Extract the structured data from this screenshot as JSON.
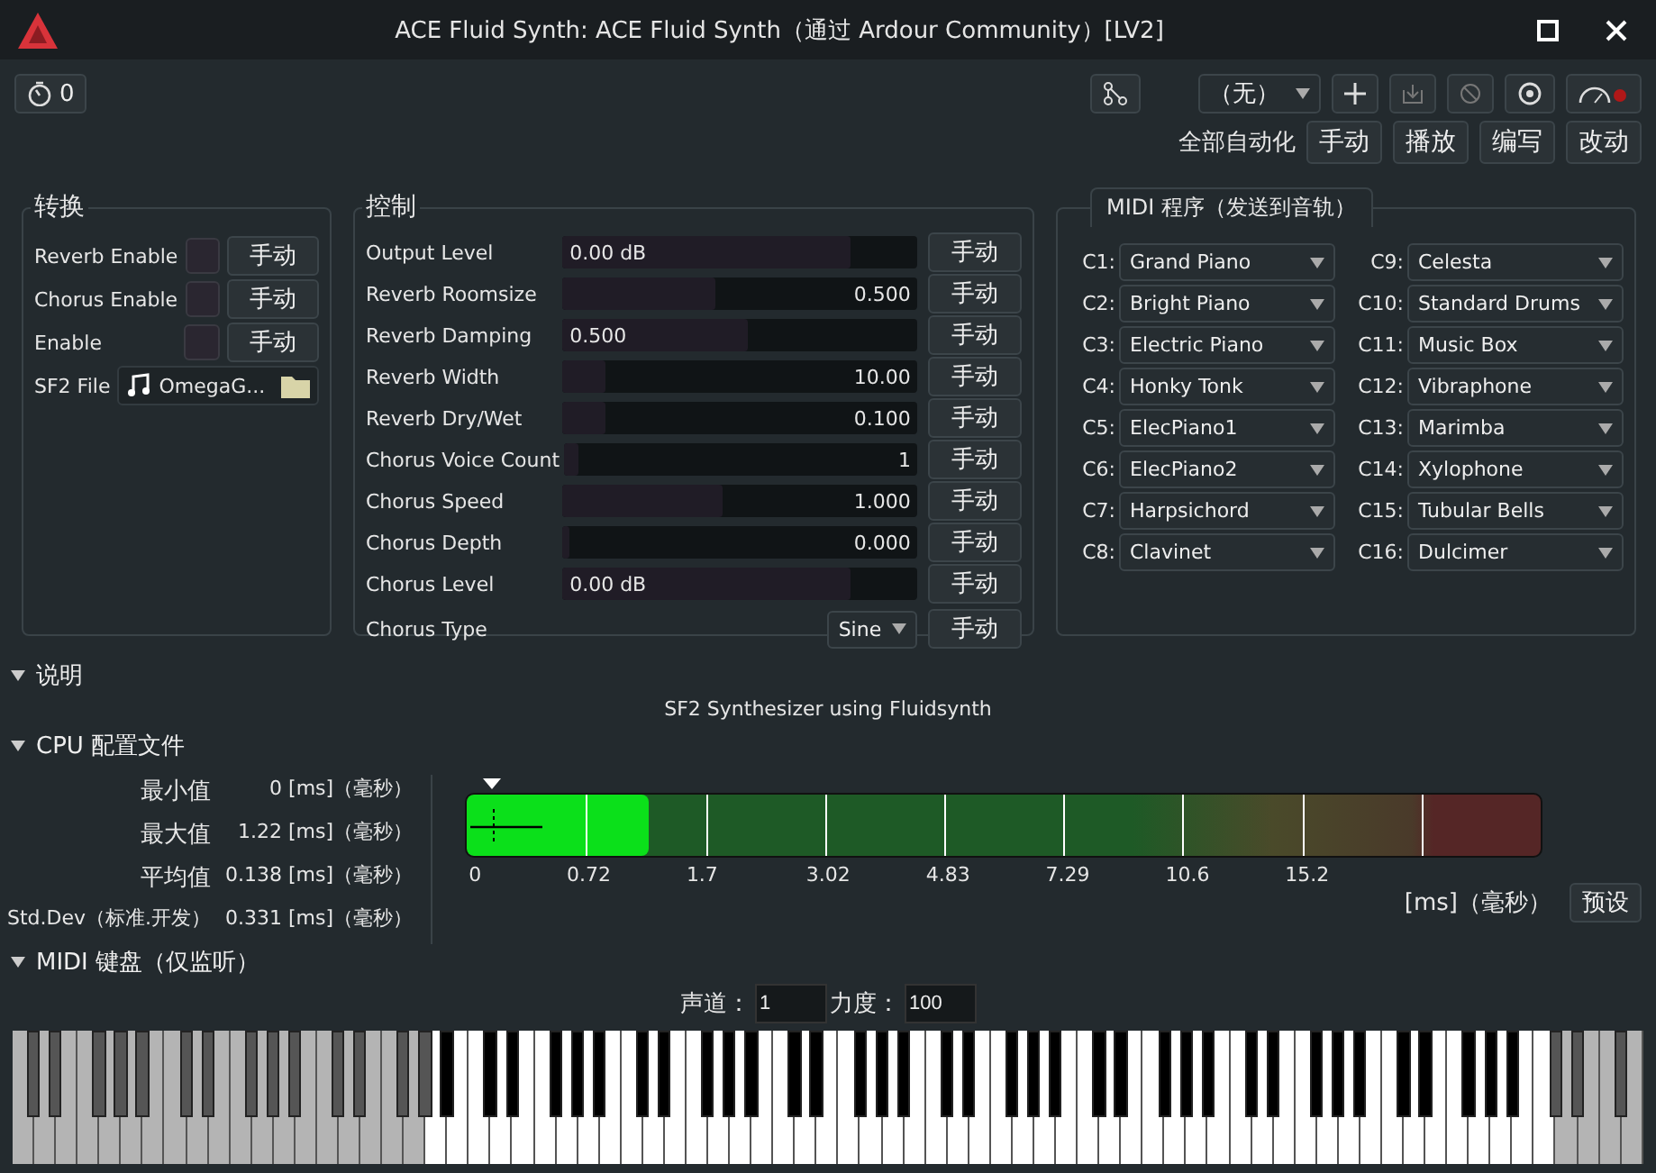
{
  "window": {
    "title": "ACE Fluid Synth: ACE Fluid Synth（通过 Ardour Community）[LV2]"
  },
  "toolbar": {
    "latency": "0",
    "preset": "（无）",
    "automation_label": "全部自动化",
    "automation_buttons": [
      "手动",
      "播放",
      "编写",
      "改动"
    ]
  },
  "switches": {
    "title": "转换",
    "items": [
      {
        "label": "Reverb Enable",
        "checked": false,
        "mode": "手动"
      },
      {
        "label": "Chorus Enable",
        "checked": false,
        "mode": "手动"
      },
      {
        "label": "Enable",
        "checked": false,
        "mode": "手动"
      }
    ],
    "file": {
      "label": "SF2 File",
      "value": "OmegaG..."
    }
  },
  "controls": {
    "title": "控制",
    "items": [
      {
        "kind": "slider",
        "label": "Output Level",
        "value": "0.00 dB",
        "level": 0.81,
        "mode": "手动"
      },
      {
        "kind": "slider",
        "label": "Reverb Roomsize",
        "value": "0.500",
        "level": 0.43,
        "mode": "手动"
      },
      {
        "kind": "slider",
        "label": "Reverb Damping",
        "value": "0.500",
        "level": 0.52,
        "mode": "手动"
      },
      {
        "kind": "slider",
        "label": "Reverb Width",
        "value": "10.00",
        "level": 0.12,
        "mode": "手动"
      },
      {
        "kind": "slider",
        "label": "Reverb Dry/Wet",
        "value": "0.100",
        "level": 0.12,
        "mode": "手动"
      },
      {
        "kind": "slider",
        "label": "Chorus Voice Count",
        "value": "1",
        "level": 0.04,
        "mode": "手动"
      },
      {
        "kind": "slider",
        "label": "Chorus Speed",
        "value": "1.000",
        "level": 0.45,
        "mode": "手动"
      },
      {
        "kind": "slider",
        "label": "Chorus Depth",
        "value": "0.000",
        "level": 0.02,
        "mode": "手动"
      },
      {
        "kind": "slider",
        "label": "Chorus Level",
        "value": "0.00 dB",
        "level": 0.81,
        "mode": "手动"
      },
      {
        "kind": "dropdown",
        "label": "Chorus Type",
        "value": "Sine",
        "mode": "手动"
      }
    ]
  },
  "midi_programs": {
    "title": "MIDI 程序（发送到音轨）",
    "channels": [
      {
        "label": "C1:",
        "program": "Grand Piano"
      },
      {
        "label": "C2:",
        "program": "Bright Piano"
      },
      {
        "label": "C3:",
        "program": "Electric Piano"
      },
      {
        "label": "C4:",
        "program": "Honky Tonk"
      },
      {
        "label": "C5:",
        "program": "ElecPiano1"
      },
      {
        "label": "C6:",
        "program": "ElecPiano2"
      },
      {
        "label": "C7:",
        "program": "Harpsichord"
      },
      {
        "label": "C8:",
        "program": "Clavinet"
      },
      {
        "label": "C9:",
        "program": "Celesta"
      },
      {
        "label": "C10:",
        "program": "Standard Drums"
      },
      {
        "label": "C11:",
        "program": "Music Box"
      },
      {
        "label": "C12:",
        "program": "Vibraphone"
      },
      {
        "label": "C13:",
        "program": "Marimba"
      },
      {
        "label": "C14:",
        "program": "Xylophone"
      },
      {
        "label": "C15:",
        "program": "Tubular Bells"
      },
      {
        "label": "C16:",
        "program": "Dulcimer"
      }
    ]
  },
  "description": {
    "title": "说明",
    "expanded": true,
    "text": "SF2 Synthesizer using Fluidsynth"
  },
  "cpu_profile": {
    "title": "CPU 配置文件",
    "expanded": true,
    "stats": [
      {
        "label": "最小值",
        "value": "0 [ms]（毫秒）"
      },
      {
        "label": "最大值",
        "value": "1.22 [ms]（毫秒）"
      },
      {
        "label": "平均值",
        "value": "0.138 [ms]（毫秒）"
      },
      {
        "label": "Std.Dev（标准.开发）",
        "value": "0.331 [ms]（毫秒）"
      }
    ],
    "level": 0.17,
    "ticks": [
      "0",
      "0.72",
      "1.7",
      "3.02",
      "4.83",
      "7.29",
      "10.6",
      "15.2"
    ],
    "unit": "[ms]（毫秒）",
    "reset": "预设"
  },
  "midi_keyboard": {
    "title": "MIDI 键盘（仅监听）",
    "expanded": true,
    "channel_label": "声道：",
    "channel": "1",
    "velocity_label": "力度：",
    "velocity": "100"
  }
}
